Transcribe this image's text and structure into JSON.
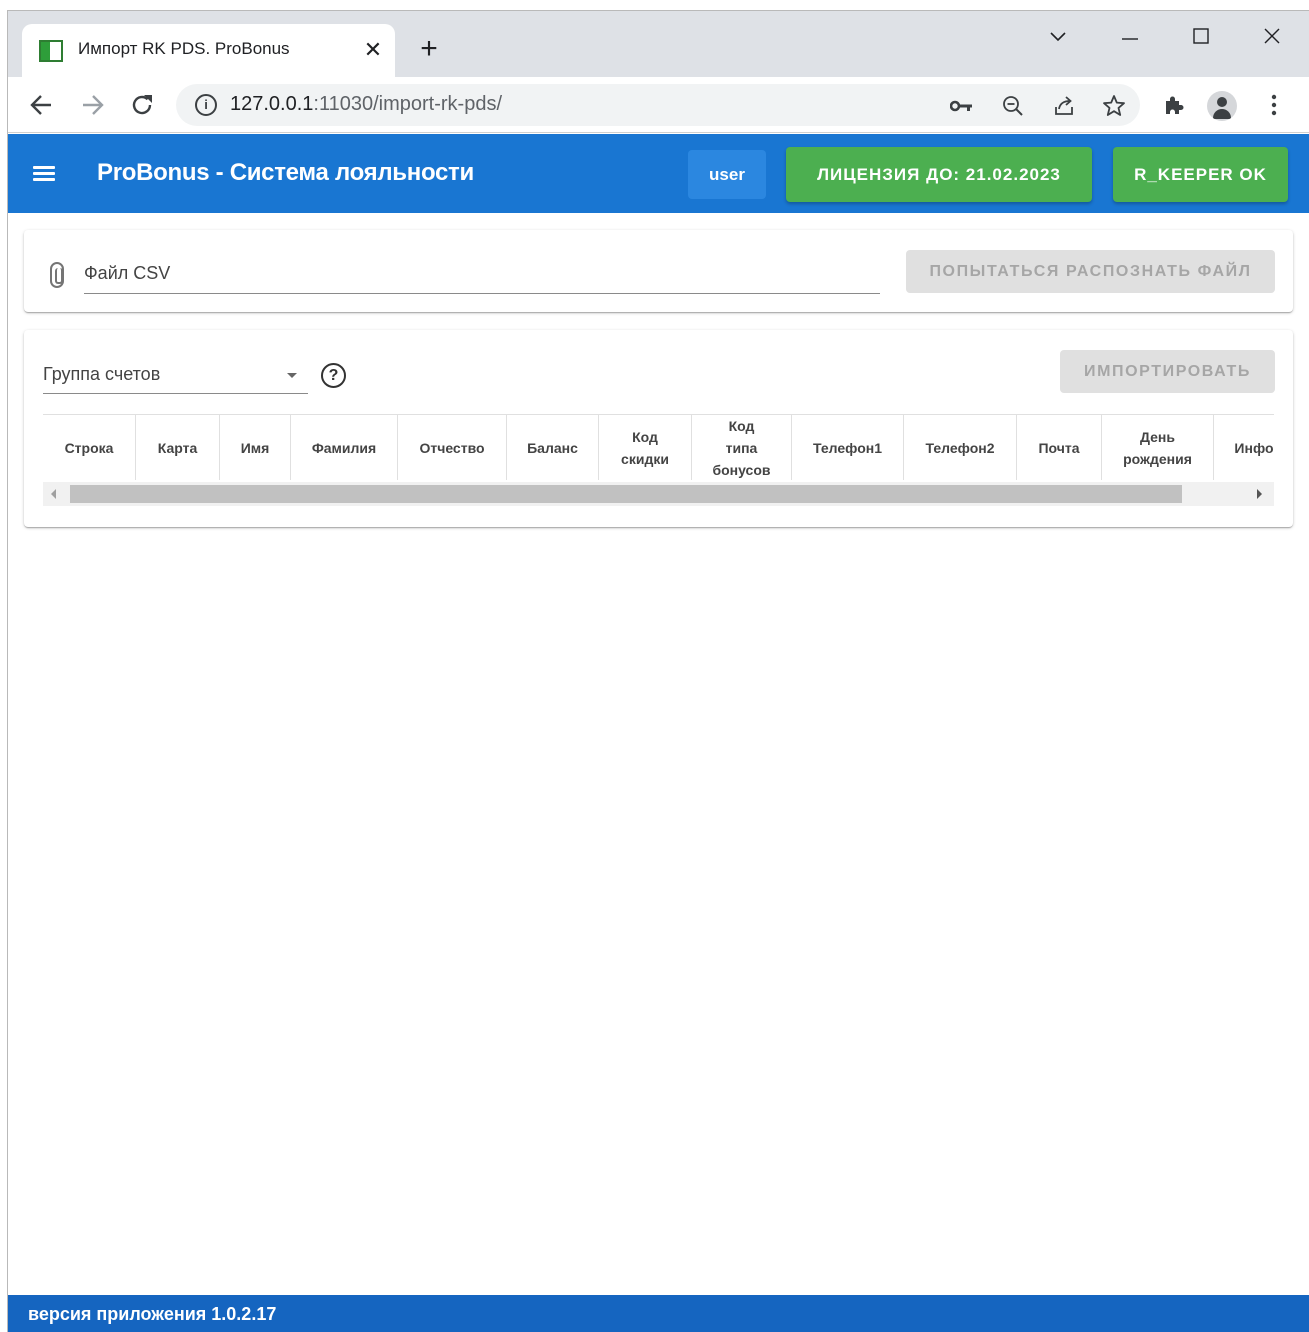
{
  "browser": {
    "tab_title": "Импорт RK PDS. ProBonus",
    "tab_close": "✕",
    "new_tab": "+",
    "url_host": "127.0.0.1",
    "url_rest": ":11030/import-rk-pds/",
    "info_glyph": "i"
  },
  "header": {
    "title": "ProBonus - Система лояльности",
    "user": "user",
    "license": "ЛИЦЕНЗИЯ ДО: 21.02.2023",
    "rkeeper": "R_KEEPER OK"
  },
  "file_card": {
    "label": "Файл CSV",
    "recognize_button": "ПОПЫТАТЬСЯ РАСПОЗНАТЬ ФАЙЛ"
  },
  "import_card": {
    "group_label": "Группа счетов",
    "help_glyph": "?",
    "import_button": "ИМПОРТИРОВАТЬ",
    "columns": [
      {
        "label": "Строка"
      },
      {
        "label": "Карта"
      },
      {
        "label": "Имя"
      },
      {
        "label": "Фамилия"
      },
      {
        "label": "Отчество"
      },
      {
        "label": "Баланс"
      },
      {
        "label": "Код\nскидки"
      },
      {
        "label": "Код\nтипа\nбонусов"
      },
      {
        "label": "Телефон1"
      },
      {
        "label": "Телефон2"
      },
      {
        "label": "Почта"
      },
      {
        "label": "День\nрождения"
      },
      {
        "label": "Инфо"
      }
    ]
  },
  "footer": {
    "version": "версия приложения 1.0.2.17"
  },
  "colors": {
    "appbar": "#1976d2",
    "footer": "#1565c0",
    "green": "#4caf50"
  }
}
